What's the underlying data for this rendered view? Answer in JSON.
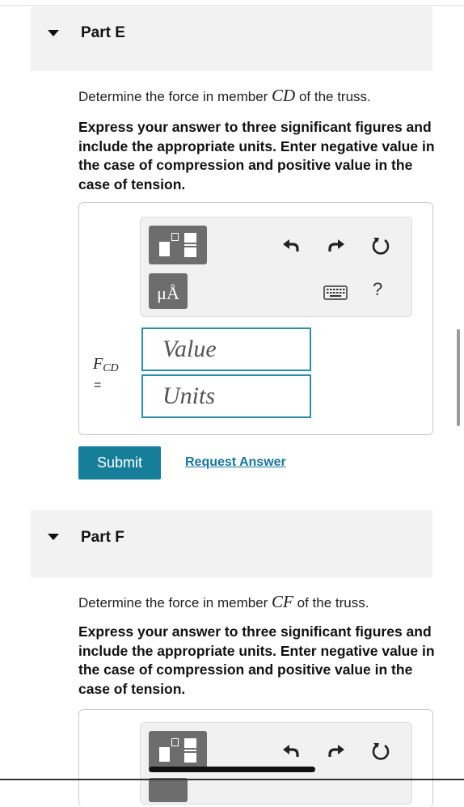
{
  "parts": [
    {
      "title": "Part E",
      "prompt_before": "Determine the force in member ",
      "prompt_math": "CD",
      "prompt_after": " of the truss.",
      "instructions": "Express your answer to three significant figures and include the appropriate units. Enter negative value in the case of compression and positive value in the case of tension.",
      "toolbar": {
        "units_symbol": "μÅ",
        "help_label": "?"
      },
      "variable": {
        "symbol": "F",
        "subscript": "CD",
        "equals": "="
      },
      "value_placeholder": "Value",
      "units_placeholder": "Units",
      "submit_label": "Submit",
      "request_answer_label": "Request Answer"
    },
    {
      "title": "Part F",
      "prompt_before": "Determine the force in member ",
      "prompt_math": "CF",
      "prompt_after": " of the truss.",
      "instructions": "Express your answer to three significant figures and include the appropriate units. Enter negative value in the case of compression and positive value in the case of tension."
    }
  ],
  "colors": {
    "accent": "#177e9a",
    "field_border": "#2c8ea8",
    "link": "#1877a2",
    "header_bg": "#f2f2f2"
  },
  "icons": {
    "collapse": "caret-down-icon",
    "template": "template-icon",
    "undo": "undo-icon",
    "redo": "redo-icon",
    "reset": "reset-icon",
    "keyboard": "keyboard-icon"
  }
}
